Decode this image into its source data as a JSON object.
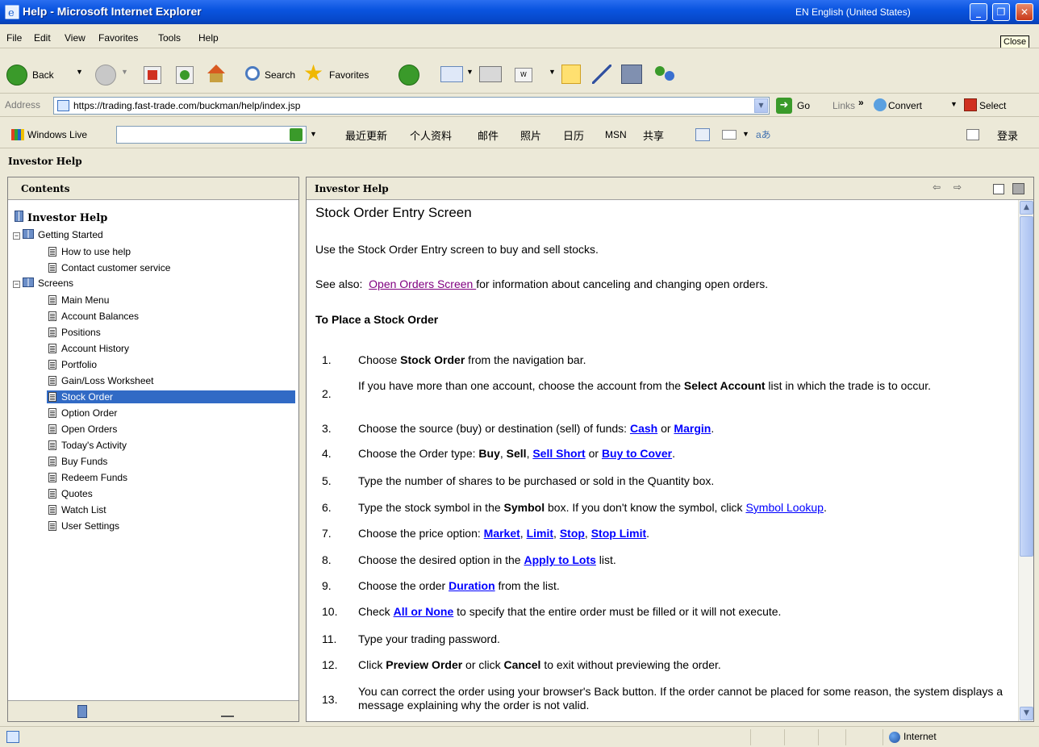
{
  "window": {
    "title": "Help - Microsoft Internet Explorer",
    "language": "EN English (United States)",
    "tooltip": "Close"
  },
  "menu": [
    "File",
    "Edit",
    "View",
    "Favorites",
    "Tools",
    "Help"
  ],
  "toolbar": {
    "back": "Back",
    "search": "Search",
    "favorites": "Favorites"
  },
  "address": {
    "label": "Address",
    "url": "https://trading.fast-trade.com/buckman/help/index.jsp",
    "go": "Go",
    "links": "Links",
    "convert": "Convert",
    "select": "Select"
  },
  "live": {
    "brand": "Windows Live",
    "items": [
      "最近更新",
      "个人资料",
      "邮件",
      "照片",
      "日历",
      "MSN",
      "共享"
    ],
    "login": "登录"
  },
  "help_title": "Investor Help",
  "contents": {
    "header": "Contents",
    "root": "Investor Help",
    "groups": [
      {
        "label": "Getting Started",
        "items": [
          "How to use help",
          "Contact customer service"
        ]
      },
      {
        "label": "Screens",
        "items": [
          "Main Menu",
          "Account Balances",
          "Positions",
          "Account History",
          "Portfolio",
          "Gain/Loss Worksheet",
          "Stock Order",
          "Option Order",
          "Open Orders",
          "Today's Activity",
          "Buy Funds",
          "Redeem Funds",
          "Quotes",
          "Watch List",
          "User Settings"
        ]
      }
    ],
    "selected": "Stock Order"
  },
  "topic": {
    "header": "Investor Help",
    "title": "Stock Order Entry Screen",
    "intro": "Use the Stock Order Entry screen to buy and sell stocks.",
    "see_also_label": "See also:",
    "see_also_link": "Open Orders Screen ",
    "see_also_rest": "for information about canceling and changing open orders.",
    "section": "To Place a Stock Order",
    "steps": [
      {
        "n": "1.",
        "parts": [
          [
            "t",
            "Choose "
          ],
          [
            "b",
            "Stock Order"
          ],
          [
            "t",
            " from the navigation bar."
          ]
        ]
      },
      {
        "n": "2.",
        "parts": [
          [
            "t",
            "If you have more than one account, choose the account from the "
          ],
          [
            "b",
            "Select Account"
          ],
          [
            "t",
            " list in which the trade is to occur."
          ]
        ]
      },
      {
        "n": "3.",
        "parts": [
          [
            "t",
            "Choose the source (buy) or destination (sell) of funds: "
          ],
          [
            "a",
            "Cash"
          ],
          [
            "t",
            " or "
          ],
          [
            "a",
            "Margin"
          ],
          [
            "t",
            "."
          ]
        ]
      },
      {
        "n": "4.",
        "parts": [
          [
            "t",
            "Choose the Order type: "
          ],
          [
            "b",
            "Buy"
          ],
          [
            "t",
            ", "
          ],
          [
            "b",
            "Sell"
          ],
          [
            "t",
            ", "
          ],
          [
            "a",
            "Sell Short"
          ],
          [
            "t",
            " or "
          ],
          [
            "a",
            "Buy to Cover"
          ],
          [
            "t",
            "."
          ]
        ]
      },
      {
        "n": "5.",
        "parts": [
          [
            "t",
            "Type the number of shares to be purchased or sold in the Quantity box."
          ]
        ]
      },
      {
        "n": "6.",
        "parts": [
          [
            "t",
            "Type the stock symbol in the "
          ],
          [
            "b",
            "Symbol"
          ],
          [
            "t",
            " box.  If you don't know the symbol, click "
          ],
          [
            "l",
            "Symbol Lookup"
          ],
          [
            "t",
            "."
          ]
        ]
      },
      {
        "n": "7.",
        "parts": [
          [
            "t",
            "Choose the price option: "
          ],
          [
            "a",
            "Market"
          ],
          [
            "t",
            ", "
          ],
          [
            "a",
            "Limit"
          ],
          [
            "t",
            ", "
          ],
          [
            "a",
            "Stop"
          ],
          [
            "t",
            ", "
          ],
          [
            "a",
            "Stop Limit"
          ],
          [
            "t",
            "."
          ]
        ]
      },
      {
        "n": "8.",
        "parts": [
          [
            "t",
            "Choose the desired option in the "
          ],
          [
            "a",
            "Apply to Lots"
          ],
          [
            "t",
            " list."
          ]
        ]
      },
      {
        "n": "9.",
        "parts": [
          [
            "t",
            "Choose the order "
          ],
          [
            "a",
            "Duration"
          ],
          [
            "t",
            " from the list."
          ]
        ]
      },
      {
        "n": "10.",
        "parts": [
          [
            "t",
            "Check "
          ],
          [
            "a",
            "All or None"
          ],
          [
            "t",
            "  to specify that the entire order must be filled or it will not execute."
          ]
        ]
      },
      {
        "n": "11.",
        "parts": [
          [
            "t",
            "Type your trading password."
          ]
        ]
      },
      {
        "n": "12.",
        "parts": [
          [
            "t",
            "Click "
          ],
          [
            "b",
            "Preview Order"
          ],
          [
            "t",
            " or click "
          ],
          [
            "b",
            "Cancel"
          ],
          [
            "t",
            " to exit without previewing the order."
          ]
        ]
      },
      {
        "n": "13.",
        "parts": [
          [
            "t",
            "You can correct the order using your browser's Back button.  If the order cannot be placed for some reason, the system displays a message explaining why the order is not valid."
          ]
        ]
      }
    ]
  },
  "status": {
    "zone": "Internet"
  }
}
